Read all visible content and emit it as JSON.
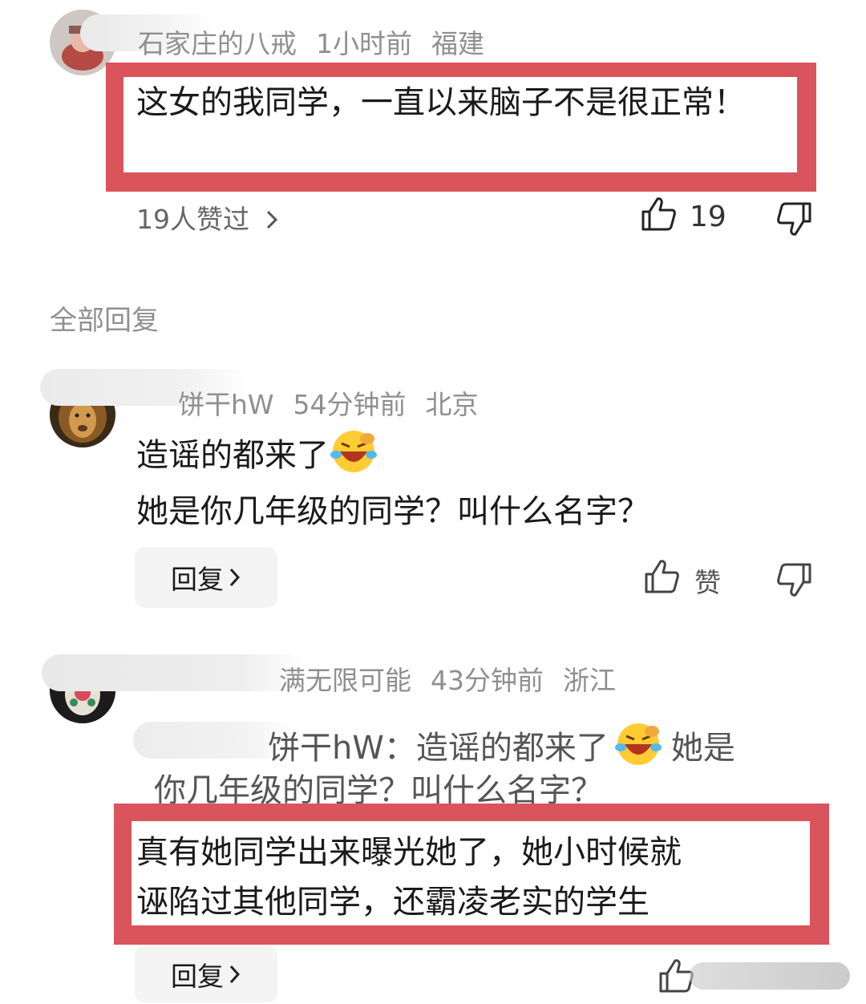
{
  "comment1": {
    "author": "石家庄的八戒",
    "time": "1小时前",
    "location": "福建",
    "text": "这女的我同学，一直以来脑子不是很正常！",
    "likes_summary": "19人赞过",
    "like_count": "19"
  },
  "replies_header": "全部回复",
  "reply1": {
    "author": "饼干hW",
    "time": "54分钟前",
    "location": "北京",
    "line1": "造谣的都来了",
    "line2": "她是你几年级的同学？叫什么名字？",
    "reply_label": "回复",
    "like_label": "赞"
  },
  "reply2": {
    "author": "满无限可能",
    "time": "43分钟前",
    "location": "浙江",
    "quote_line1": "饼干hW：造谣的都来了",
    "quote_line1_tail": "她是",
    "quote_line2": "你几年级的同学？叫什么名字？",
    "text_line1": "真有她同学出来曝光她了，她小时候就",
    "text_line2": "诬陷过其他同学，还霸凌老实的学生",
    "reply_label": "回复"
  },
  "icons": {
    "chevron": "chevron-right-icon",
    "like": "thumbs-up-icon",
    "dislike": "thumbs-down-icon",
    "emoji": "laughing-crying-emoji"
  },
  "colors": {
    "highlight_red": "#d9545b",
    "meta_gray": "#8f8f8f"
  }
}
